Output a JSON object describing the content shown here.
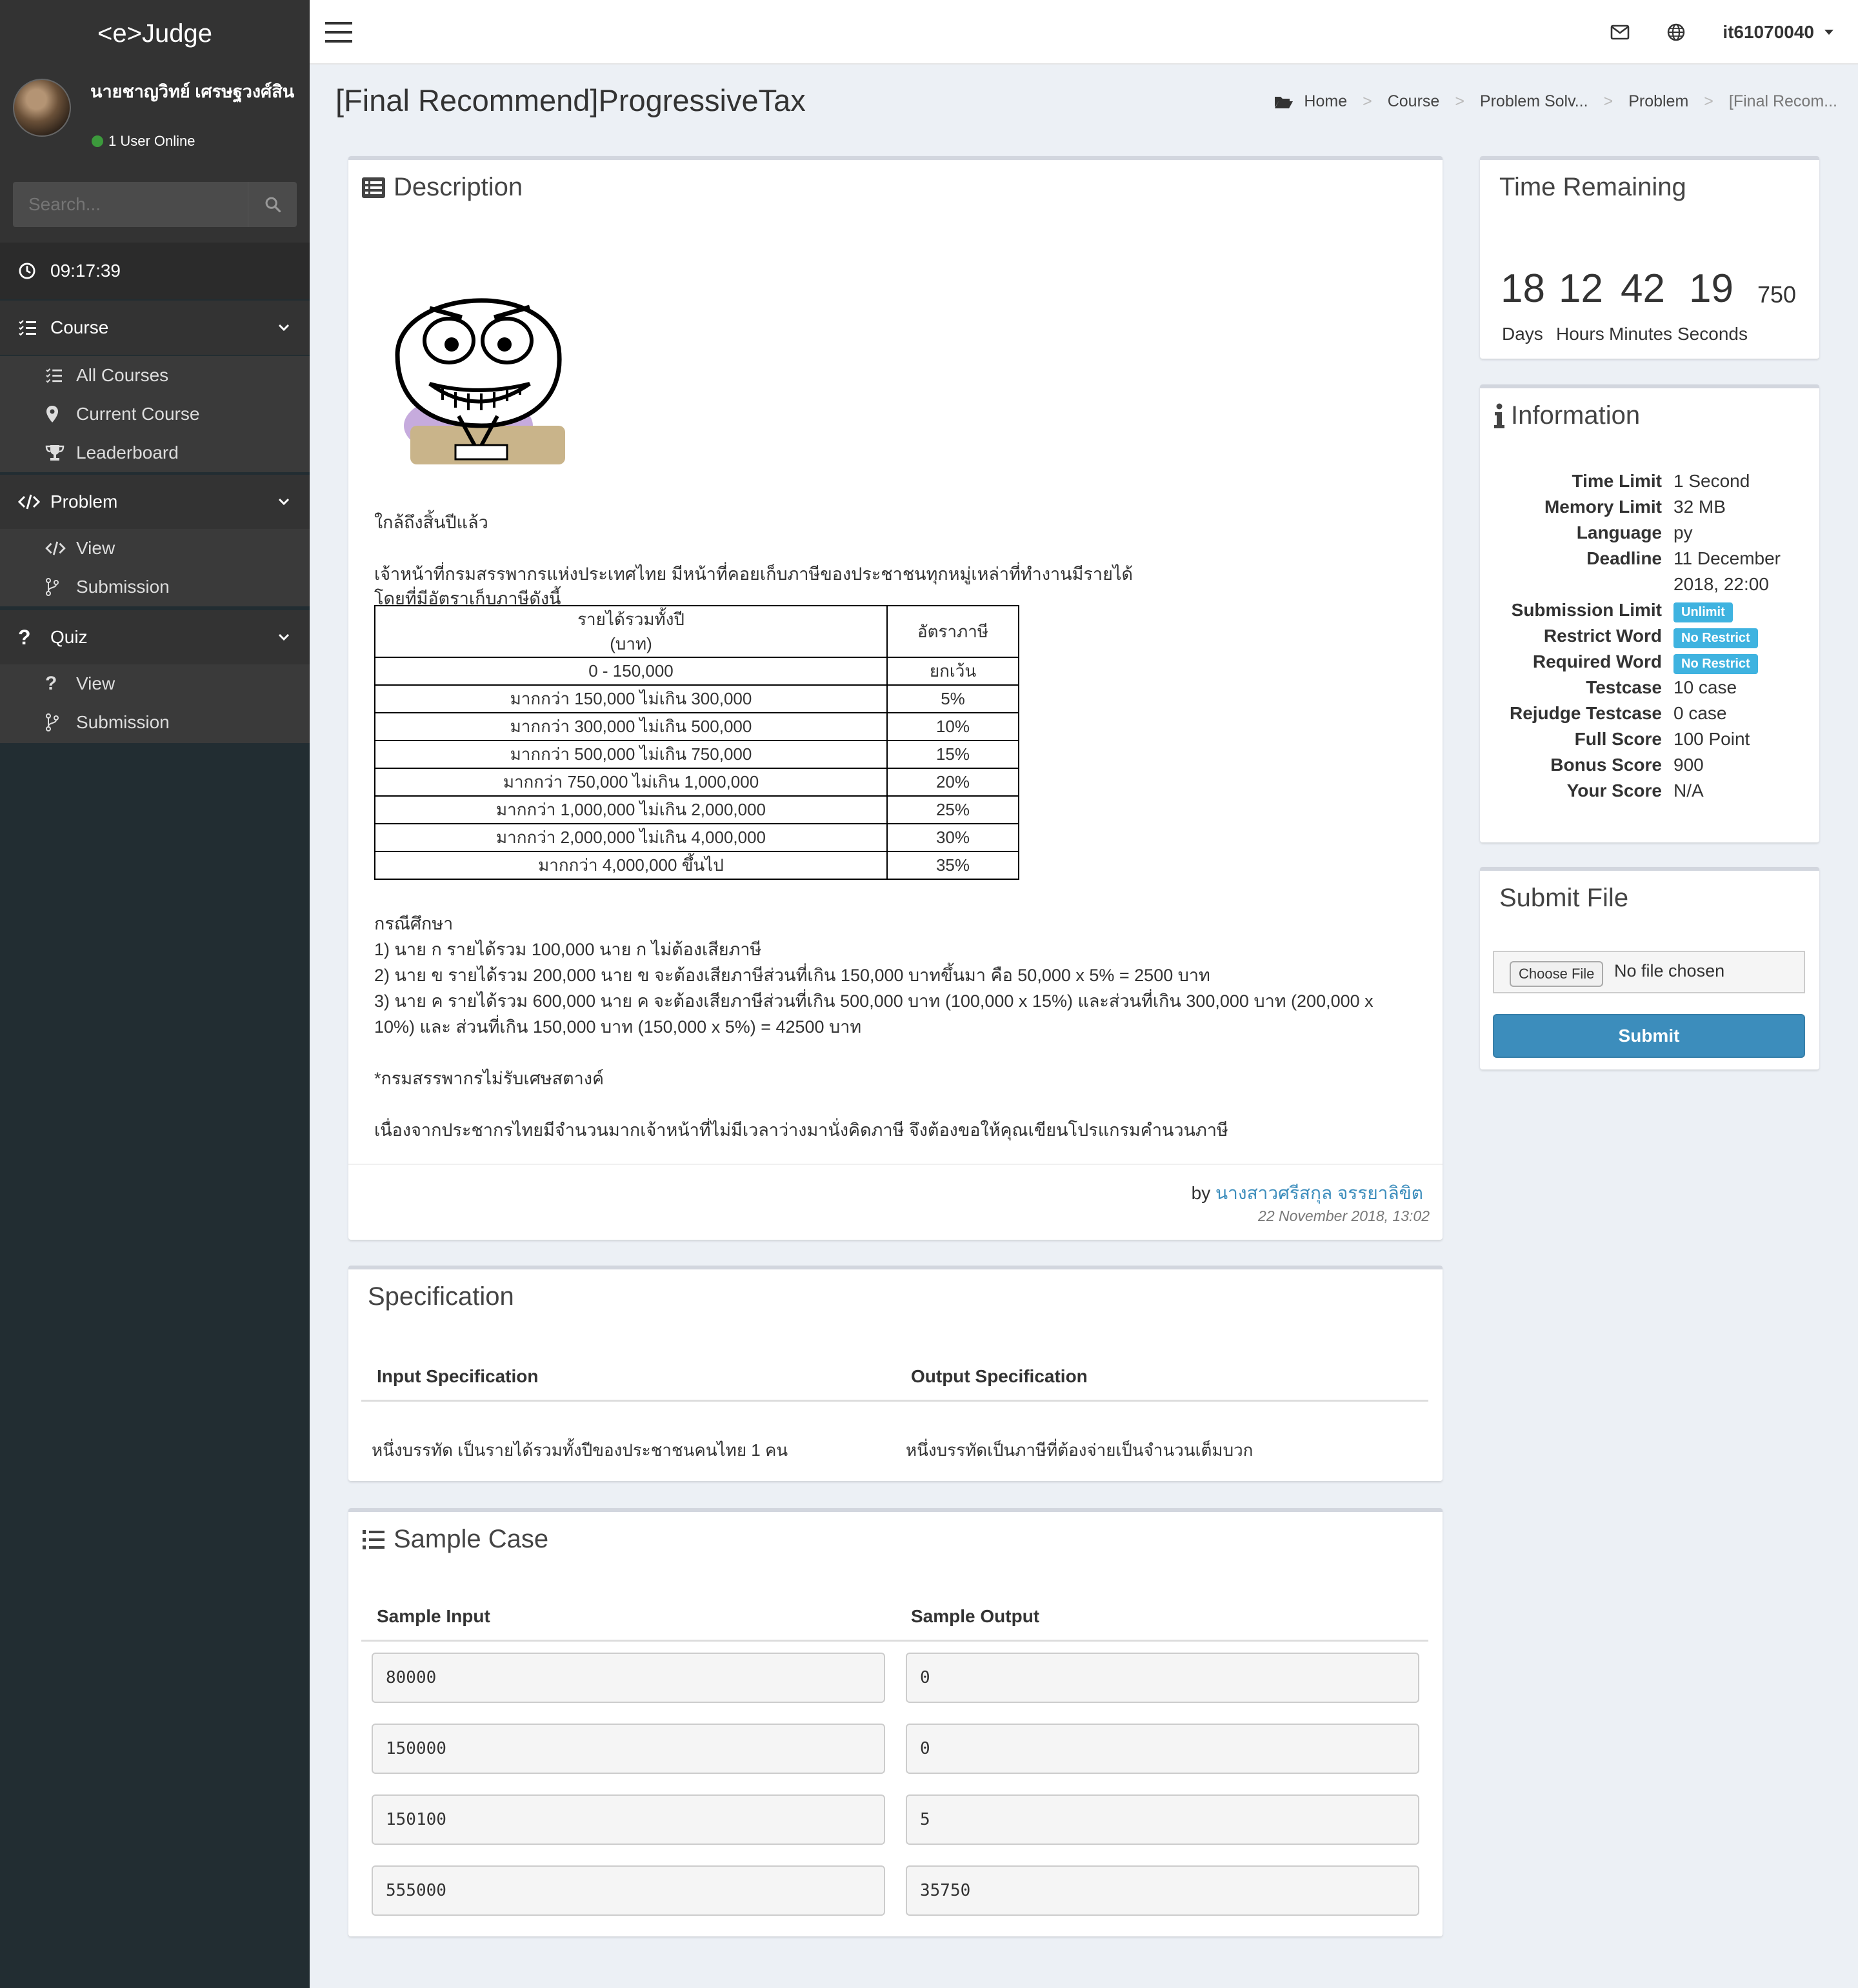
{
  "app": {
    "brand": "<e>Judge"
  },
  "user": {
    "name": "นายชาญวิทย์ เศรษฐวงศ์สิน",
    "online_text": "1 User Online",
    "username": "it61070040"
  },
  "search": {
    "placeholder": "Search..."
  },
  "clock": "09:17:39",
  "sidebar": {
    "course": {
      "label": "Course",
      "items": [
        "All Courses",
        "Current Course",
        "Leaderboard"
      ]
    },
    "problem": {
      "label": "Problem",
      "items": [
        "View",
        "Submission"
      ]
    },
    "quiz": {
      "label": "Quiz",
      "items": [
        "View",
        "Submission"
      ]
    }
  },
  "page": {
    "title": "[Final Recommend]ProgressiveTax"
  },
  "breadcrumb": [
    "Home",
    "Course",
    "Problem Solv...",
    "Problem",
    "[Final Recom..."
  ],
  "description": {
    "title": "Description",
    "line1": "ใกล้ถึงสิ้นปีแล้ว",
    "line2": "เจ้าหน้าที่กรมสรรพากรแห่งประเทศไทย มีหน้าที่คอยเก็บภาษีของประชาชนทุกหมู่เหล่าที่ทำงานมีรายได้",
    "line3": "โดยที่มีอัตราเก็บภาษีดังนี้",
    "table_header": [
      "รายได้รวมทั้งปี",
      "(บาท)",
      "อัตราภาษี"
    ],
    "table_rows": [
      [
        "0 - 150,000",
        "ยกเว้น"
      ],
      [
        "มากกว่า 150,000  ไม่เกิน 300,000",
        "5%"
      ],
      [
        "มากกว่า 300,000  ไม่เกิน 500,000",
        "10%"
      ],
      [
        "มากกว่า 500,000  ไม่เกิน 750,000",
        "15%"
      ],
      [
        "มากกว่า 750,000  ไม่เกิน 1,000,000",
        "20%"
      ],
      [
        "มากกว่า 1,000,000  ไม่เกิน 2,000,000",
        "25%"
      ],
      [
        "มากกว่า 2,000,000  ไม่เกิน 4,000,000",
        "30%"
      ],
      [
        "มากกว่า 4,000,000 ขึ้นไป",
        "35%"
      ]
    ],
    "case_title": "กรณีศึกษา",
    "case1": "1) นาย ก รายได้รวม 100,000 นาย ก ไม่ต้องเสียภาษี",
    "case2": "2) นาย ข รายได้รวม 200,000 นาย ข จะต้องเสียภาษีส่วนที่เกิน 150,000 บาทขึ้นมา คือ 50,000 x 5% = 2500 บาท",
    "case3a": "3) นาย ค รายได้รวม 600,000 นาย ค จะต้องเสียภาษีส่วนที่เกิน 500,000 บาท (100,000 x 15%) และส่วนที่เกิน 300,000 บาท (200,000 x",
    "case3b": "10%) และ ส่วนที่เกิน 150,000 บาท (150,000 x 5%) = 42500 บาท",
    "note": "*กรมสรรพากรไม่รับเศษสตางค์",
    "closing": "เนื่องจากประชากรไทยมีจำนวนมากเจ้าหน้าที่ไม่มีเวลาว่างมานั่งคิดภาษี จึงต้องขอให้คุณเขียนโปรแกรมคำนวนภาษี",
    "by_label": "by",
    "author": "นางสาวศรีสกุล จรรยาลิขิต",
    "date": "22 November 2018, 13:02"
  },
  "specification": {
    "title": "Specification",
    "input_header": "Input Specification",
    "output_header": "Output Specification",
    "input": "หนึ่งบรรทัด เป็นรายได้รวมทั้งปีของประชาชนคนไทย 1 คน",
    "output": "หนึ่งบรรทัดเป็นภาษีที่ต้องจ่ายเป็นจำนวนเต็มบวก"
  },
  "sample": {
    "title": "Sample Case",
    "input_header": "Sample Input",
    "output_header": "Sample Output",
    "rows": [
      [
        "80000",
        "0"
      ],
      [
        "150000",
        "0"
      ],
      [
        "150100",
        "5"
      ],
      [
        "555000",
        "35750"
      ]
    ]
  },
  "time_remaining": {
    "title": "Time Remaining",
    "days": "18",
    "hours": "12",
    "minutes": "42",
    "seconds": "19",
    "ms": "750",
    "labels": [
      "Days",
      "Hours",
      "Minutes",
      "Seconds"
    ]
  },
  "information": {
    "title": "Information",
    "rows": [
      [
        "Time Limit",
        "1 Second"
      ],
      [
        "Memory Limit",
        "32 MB"
      ],
      [
        "Language",
        "py"
      ],
      [
        "Deadline",
        "11 December"
      ],
      [
        "",
        "2018, 22:00"
      ],
      [
        "Submission Limit",
        "Unlimit"
      ],
      [
        "Restrict Word",
        "No Restrict"
      ],
      [
        "Required Word",
        "No Restrict"
      ],
      [
        "Testcase",
        "10 case"
      ],
      [
        "Rejudge Testcase",
        "0 case"
      ],
      [
        "Full Score",
        "100 Point"
      ],
      [
        "Bonus Score",
        "900"
      ],
      [
        "Your Score",
        "N/A"
      ]
    ]
  },
  "submit_file": {
    "title": "Submit File",
    "choose_label": "Choose File",
    "no_file": "No file chosen",
    "submit_label": "Submit"
  },
  "colors": {
    "sidebar_bg": "#222d32",
    "accent": "#3c8dbc",
    "badge": "#3fb3e0"
  }
}
